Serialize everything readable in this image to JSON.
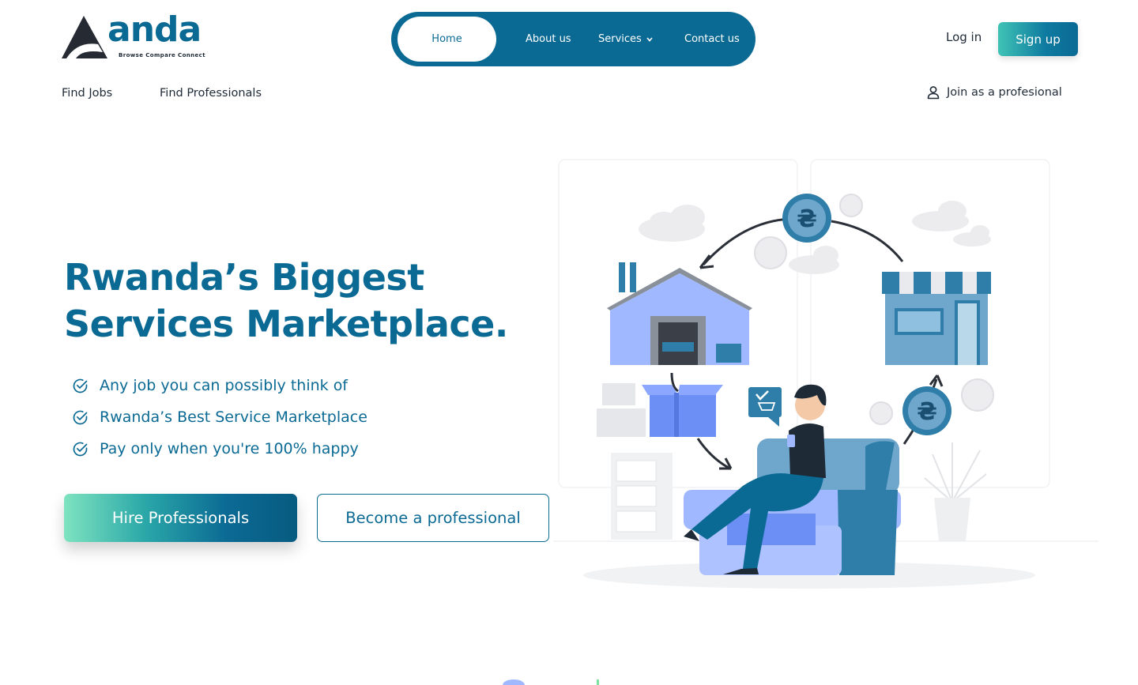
{
  "brand": {
    "name": "anda",
    "tagline": "Browse Compare Connect",
    "color": "#0b6a94"
  },
  "nav": {
    "items": [
      {
        "label": "Home",
        "active": true
      },
      {
        "label": "About us"
      },
      {
        "label": "Services",
        "icon": "chevron-down-icon"
      },
      {
        "label": "Contact us"
      }
    ]
  },
  "auth": {
    "login_label": "Log in",
    "signup_label": "Sign up"
  },
  "subnav": {
    "find_jobs": "Find Jobs",
    "find_professionals": "Find Professionals",
    "join_professional": "Join as a profesional",
    "join_icon": "user-icon"
  },
  "hero": {
    "title_line1": "Rwanda’s Biggest",
    "title_line2": "Services Marketplace.",
    "features": [
      "Any job you can possibly think of",
      "Rwanda’s Best Service Marketplace",
      "Pay only when you're 100% happy"
    ],
    "feature_icon": "check-circle-icon",
    "primary_cta": "Hire Professionals",
    "secondary_cta": "Become a professional"
  },
  "colors": {
    "primary": "#0b6a94",
    "accent_gradient_start": "#7ee3c0",
    "illustration_blue": "#9fb8ff"
  }
}
